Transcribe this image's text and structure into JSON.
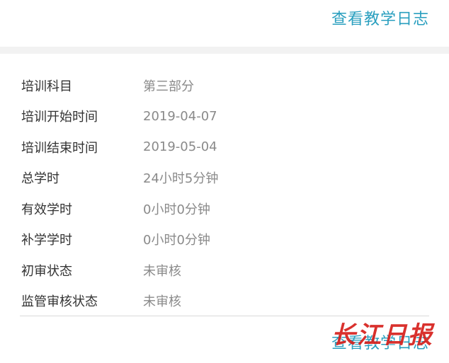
{
  "header": {
    "view_log_label": "查看教学日志"
  },
  "training_info": {
    "rows": [
      {
        "label": "培训科目",
        "value": "第三部分"
      },
      {
        "label": "培训开始时间",
        "value": "2019-04-07"
      },
      {
        "label": "培训结束时间",
        "value": "2019-05-04"
      },
      {
        "label": "总学时",
        "value": "24小时5分钟"
      },
      {
        "label": "有效学时",
        "value": "0小时0分钟"
      },
      {
        "label": "补学学时",
        "value": "0小时0分钟"
      },
      {
        "label": "初审状态",
        "value": "未审核"
      },
      {
        "label": "监管审核状态",
        "value": "未审核"
      }
    ]
  },
  "footer": {
    "view_log_label": "查看教学日志"
  },
  "watermark": {
    "text": "长江日报"
  },
  "colors": {
    "link": "#2a9fbf",
    "label": "#333333",
    "value": "#8a8a8a",
    "band": "#f2f2f2",
    "watermark": "#d6201c"
  }
}
